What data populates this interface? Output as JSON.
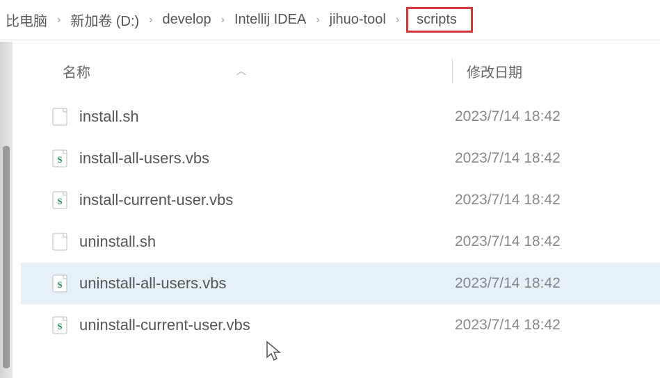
{
  "breadcrumb": {
    "items": [
      {
        "label": "比电脑"
      },
      {
        "label": "新加卷 (D:)"
      },
      {
        "label": "develop"
      },
      {
        "label": "Intellij IDEA"
      },
      {
        "label": "jihuo-tool"
      },
      {
        "label": "scripts"
      }
    ]
  },
  "columns": {
    "name": "名称",
    "date": "修改日期"
  },
  "files": [
    {
      "name": "install.sh",
      "date": "2023/7/14 18:42",
      "icon": "generic"
    },
    {
      "name": "install-all-users.vbs",
      "date": "2023/7/14 18:42",
      "icon": "vbs"
    },
    {
      "name": "install-current-user.vbs",
      "date": "2023/7/14 18:42",
      "icon": "vbs"
    },
    {
      "name": "uninstall.sh",
      "date": "2023/7/14 18:42",
      "icon": "generic"
    },
    {
      "name": "uninstall-all-users.vbs",
      "date": "2023/7/14 18:42",
      "icon": "vbs",
      "selected": true
    },
    {
      "name": "uninstall-current-user.vbs",
      "date": "2023/7/14 18:42",
      "icon": "vbs"
    }
  ]
}
